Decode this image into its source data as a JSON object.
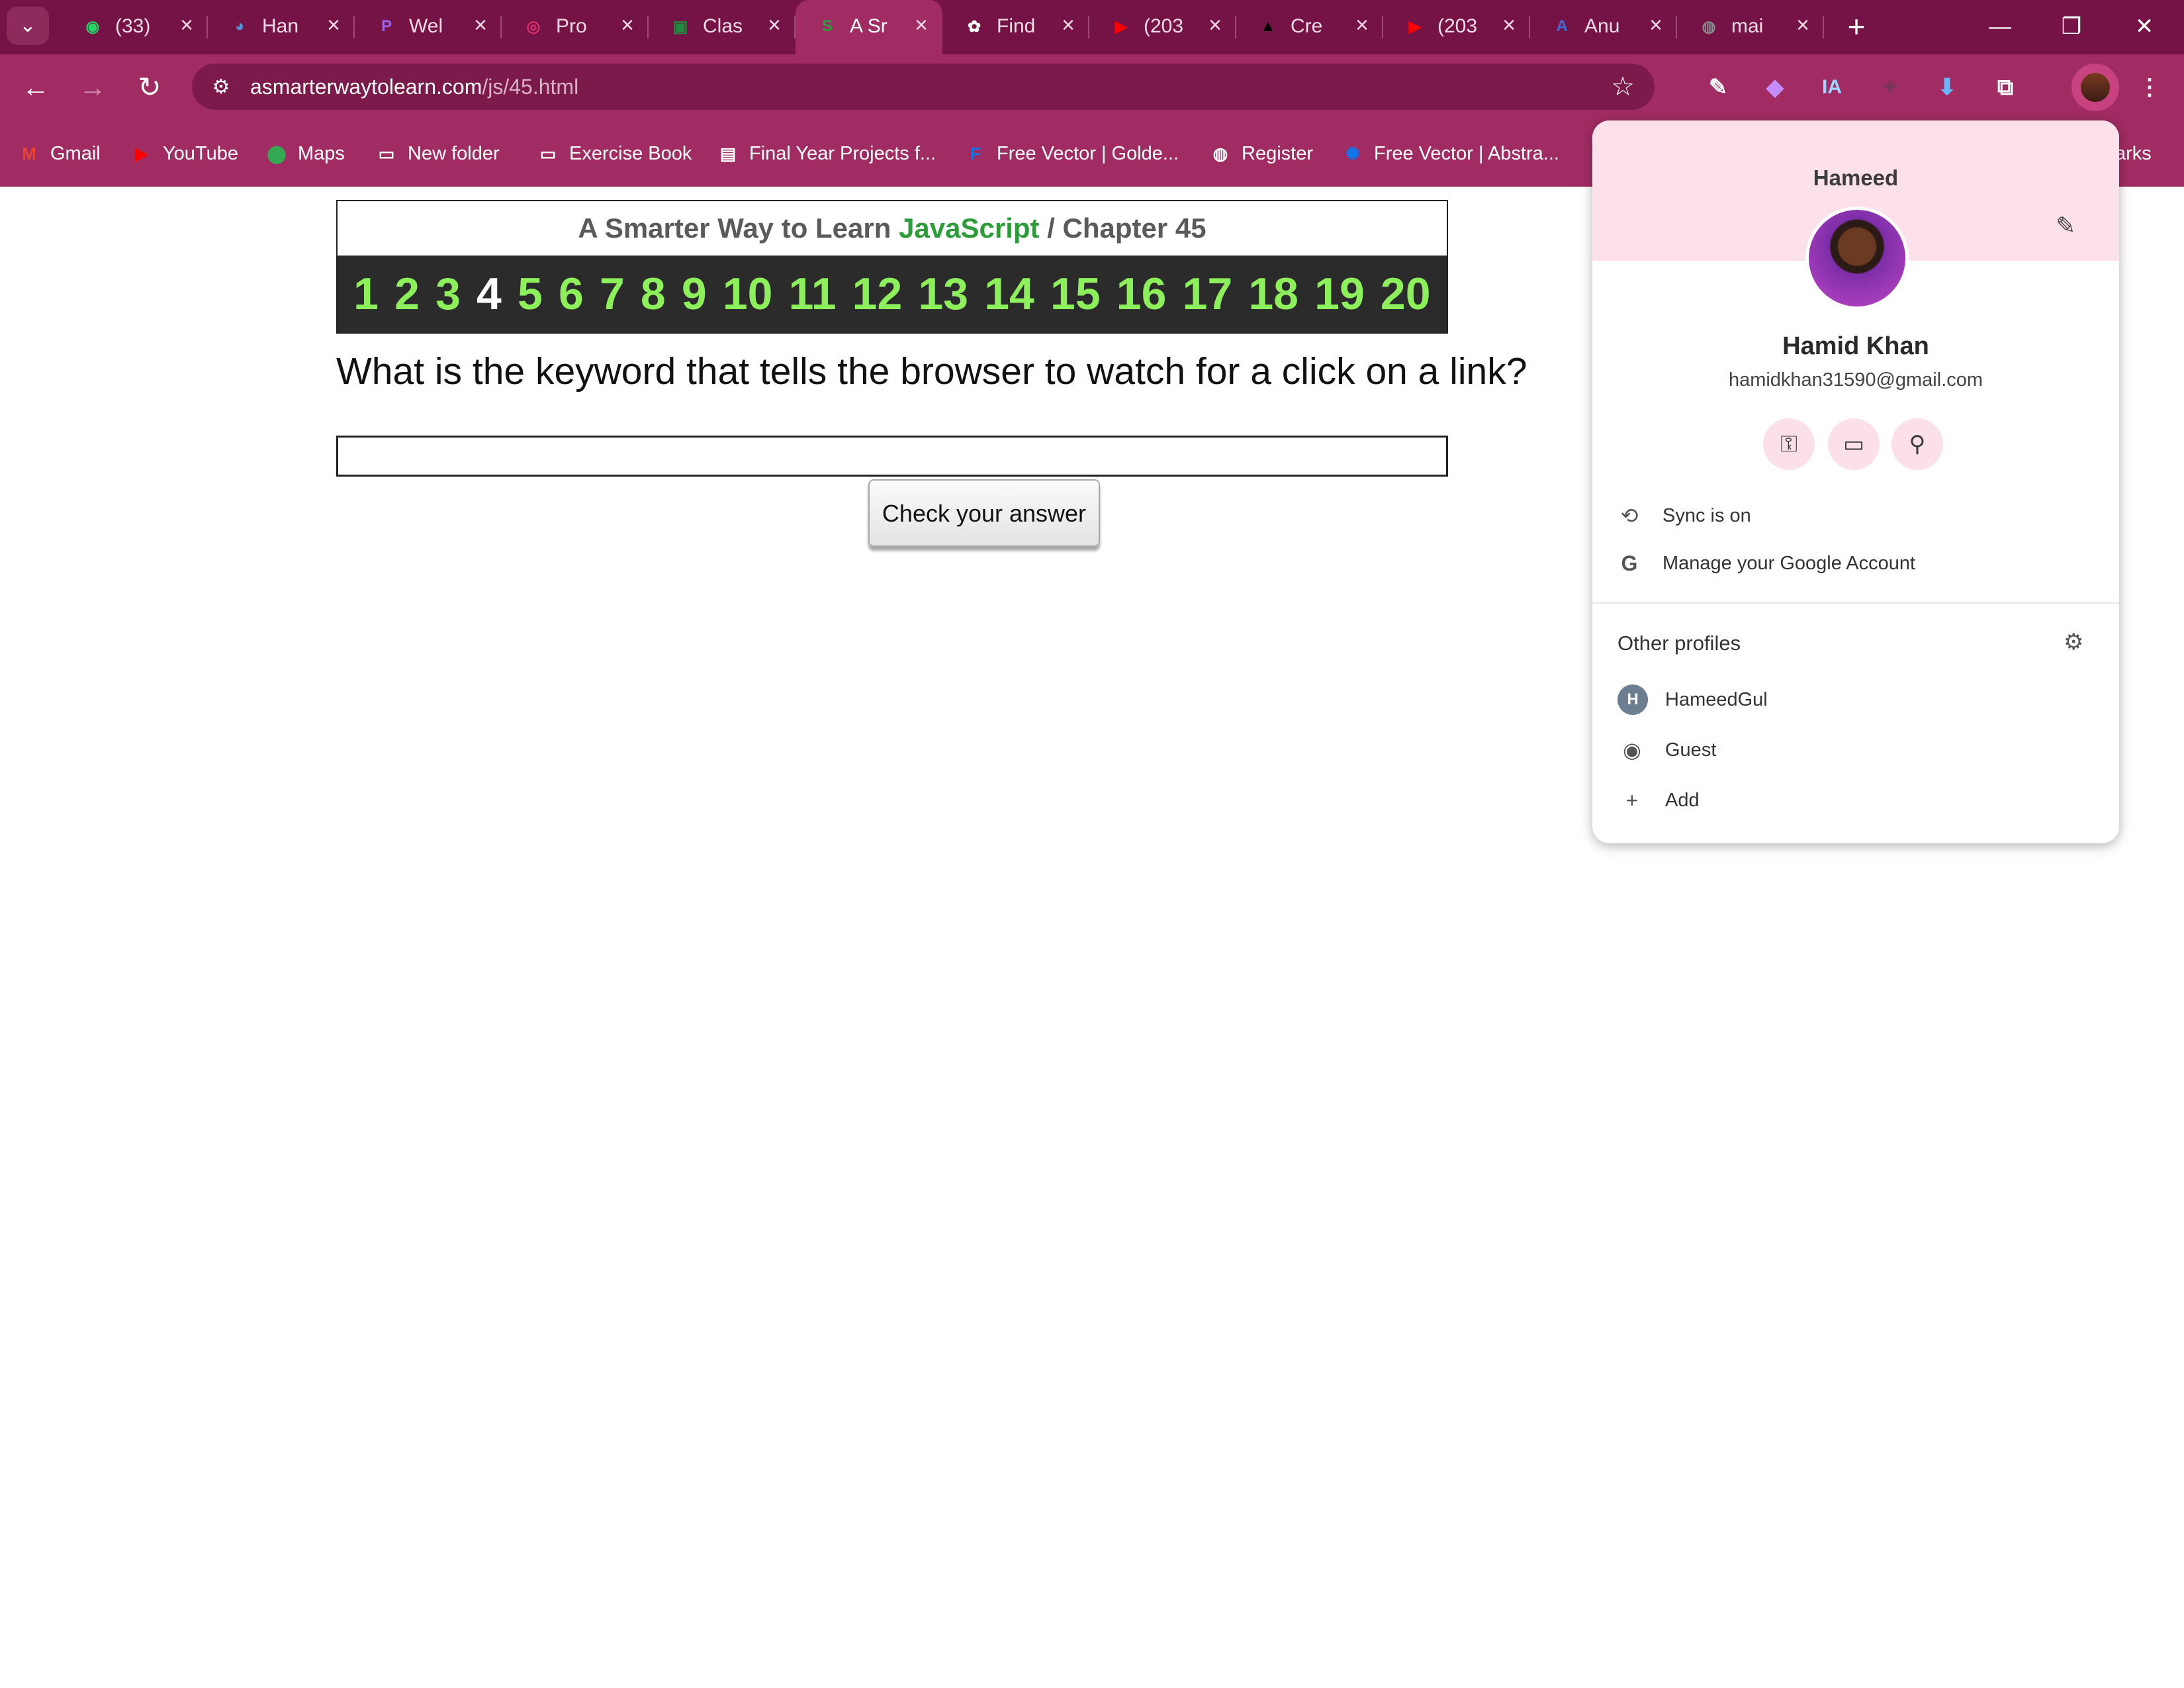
{
  "tabs": [
    {
      "title": "(33)",
      "icon": "whatsapp-icon",
      "color": "#25d366",
      "glyph": "◉"
    },
    {
      "title": "Han",
      "icon": "profile-icon",
      "color": "#5b8fd9",
      "glyph": "◕"
    },
    {
      "title": "Wel",
      "icon": "p-logo-icon",
      "color": "#9d64e8",
      "glyph": "P"
    },
    {
      "title": "Pro",
      "icon": "instagram-icon",
      "color": "#e1306c",
      "glyph": "◎"
    },
    {
      "title": "Clas",
      "icon": "classroom-icon",
      "color": "#1e8e3e",
      "glyph": "▣"
    },
    {
      "title": "A Sr",
      "icon": "s-logo-icon",
      "color": "#2e9c3a",
      "glyph": "S",
      "active": true
    },
    {
      "title": "Find",
      "icon": "chatgpt-icon",
      "color": "#ffffff",
      "glyph": "✿"
    },
    {
      "title": "(203",
      "icon": "youtube-icon",
      "color": "#ff0000",
      "glyph": "▶"
    },
    {
      "title": "Cre",
      "icon": "triangle-logo-icon",
      "color": "#000000",
      "glyph": "▲"
    },
    {
      "title": "(203",
      "icon": "youtube-icon",
      "color": "#ff0000",
      "glyph": "▶"
    },
    {
      "title": "Anu",
      "icon": "a-logo-icon",
      "color": "#3d6fd8",
      "glyph": "A"
    },
    {
      "title": "mai",
      "icon": "globe-icon",
      "color": "#8a8a8a",
      "glyph": "◍"
    }
  ],
  "address": {
    "domain": "asmarterwaytolearn.com",
    "path": "/js/45.html"
  },
  "bookmarks": [
    {
      "label": "Gmail",
      "icon": "gmail-icon",
      "color": "#ea4335",
      "glyph": "M"
    },
    {
      "label": "YouTube",
      "icon": "youtube-icon",
      "color": "#ff0000",
      "glyph": "▶"
    },
    {
      "label": "Maps",
      "icon": "maps-pin-icon",
      "color": "#34a853",
      "glyph": "⬤"
    },
    {
      "label": "New folder",
      "icon": "folder-icon",
      "color": "#ffffff",
      "glyph": "▭"
    },
    {
      "label": "Exercise Book",
      "icon": "folder-icon",
      "color": "#ffffff",
      "glyph": "▭"
    },
    {
      "label": "Final Year Projects f...",
      "icon": "doc-icon",
      "color": "#ffffff",
      "glyph": "▤"
    },
    {
      "label": "Free Vector | Golde...",
      "icon": "freepik-icon",
      "color": "#1273eb",
      "glyph": "F"
    },
    {
      "label": "Register",
      "icon": "globe-icon",
      "color": "#ffffff",
      "glyph": "◍"
    },
    {
      "label": "Free Vector | Abstra...",
      "icon": "freepik-icon",
      "color": "#1273eb",
      "glyph": "✺"
    }
  ],
  "bookmarks_overflow": "arks",
  "page": {
    "title_prefix": "A Smarter Way to Learn",
    "title_js": "JavaScript",
    "title_sep": "/",
    "title_chapter": "Chapter 45",
    "numbers": [
      "1",
      "2",
      "3",
      "4",
      "5",
      "6",
      "7",
      "8",
      "9",
      "10",
      "11",
      "12",
      "13",
      "14",
      "15",
      "16",
      "17",
      "18",
      "19",
      "20"
    ],
    "current_number": "4",
    "question": "What is the keyword that tells the browser to watch for a click on a link?",
    "answer_value": "",
    "check_button": "Check your answer"
  },
  "profile": {
    "profile_name": "Hameed",
    "full_name": "Hamid Khan",
    "email": "hamidkhan31590@gmail.com",
    "sync": "Sync is on",
    "manage": "Manage your Google Account",
    "other_profiles_label": "Other profiles",
    "others": [
      {
        "name": "HameedGul",
        "badge": "H"
      },
      {
        "name": "Guest"
      },
      {
        "name": "Add"
      }
    ]
  },
  "colors": {
    "tabbar": "#761346",
    "toolbar": "#a12c63",
    "accent_green": "#2e9c3a",
    "number_green": "#8eef5c"
  }
}
